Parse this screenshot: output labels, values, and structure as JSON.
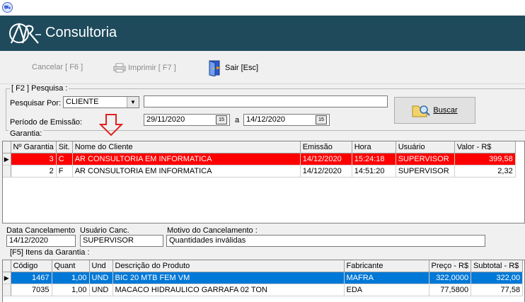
{
  "window": {
    "icon": "app-cart-icon"
  },
  "banner": {
    "brand": "Consultoria",
    "logo_text": "AR"
  },
  "toolbar": {
    "cancel_label": "Cancelar [ F6 ]",
    "print_label": "Imprimir  [ F7 ]",
    "exit_label": "Sair  [Esc]"
  },
  "search": {
    "group_label": "[ F2 ]  Pesquisa :",
    "search_by_label": "Pesquisar Por:",
    "search_by_value": "CLIENTE",
    "search_text": "",
    "period_label": "Período de Emissão:",
    "date_from": "29/11/2020",
    "date_sep": "a",
    "date_to": "14/12/2020",
    "search_button": "Buscar"
  },
  "guarantees": {
    "group_label": "Garantia:",
    "columns": [
      "Nº Garantia",
      "Sit.",
      "Nome do Cliente",
      "Emissão",
      "Hora",
      "Usuário",
      "Valor - R$"
    ],
    "rows": [
      [
        "3",
        "C",
        "AR CONSULTORIA EM INFORMATICA",
        "14/12/2020",
        "15:24:18",
        "SUPERVISOR",
        "399,58"
      ],
      [
        "2",
        "F",
        "AR CONSULTORIA EM INFORMATICA",
        "14/12/2020",
        "14:51:20",
        "SUPERVISOR",
        "2,32"
      ]
    ]
  },
  "cancellation": {
    "date_label": "Data Cancelamento",
    "date_value": "14/12/2020",
    "user_label": "Usuário Canc.",
    "user_value": "SUPERVISOR",
    "reason_label": "Motivo do Cancelamento  :",
    "reason_value": "Quantidades inválidas"
  },
  "items": {
    "group_label": "[F5]  Itens da Garantia  :",
    "columns": [
      "Código",
      "Quant",
      "Und",
      "Descrição do Produto",
      "Fabricante",
      "Preço - R$",
      "Subtotal - R$"
    ],
    "rows": [
      [
        "1467",
        "1,00",
        "UND",
        "BIC 20 MTB FEM VM",
        "MAFRA",
        "322,0000",
        "322,00"
      ],
      [
        "7035",
        "1,00",
        "UND",
        "MACACO HIDRAULICO GARRAFA 02 TON",
        "EDA",
        "77,5800",
        "77,58"
      ]
    ]
  },
  "colors": {
    "banner": "#1e4a5c",
    "selected_red": "#ff0000",
    "selected_blue": "#0078d7",
    "arrow": "#e02020"
  }
}
